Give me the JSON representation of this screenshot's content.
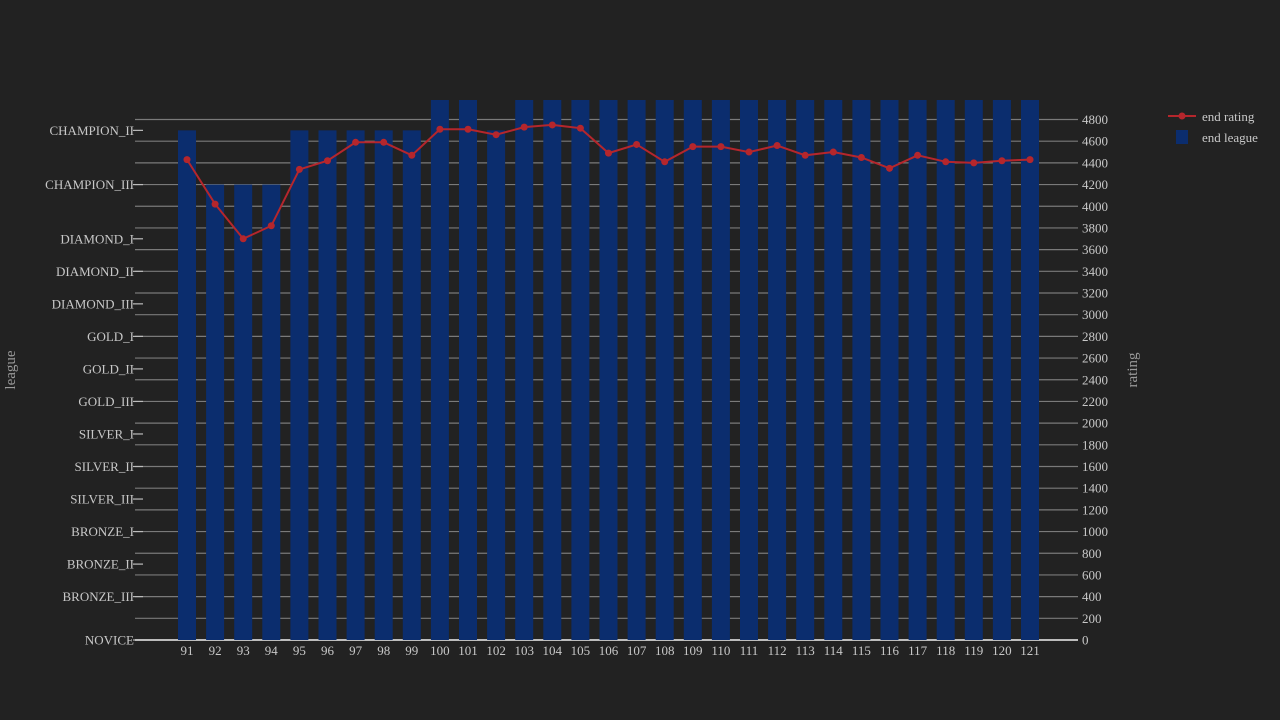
{
  "chart_data": {
    "type": "bar+line",
    "title": "",
    "xlabel": "",
    "ylabel_left": "league",
    "ylabel_right": "rating",
    "x": [
      91,
      92,
      93,
      94,
      95,
      96,
      97,
      98,
      99,
      100,
      101,
      102,
      103,
      104,
      105,
      106,
      107,
      108,
      109,
      110,
      111,
      112,
      113,
      114,
      115,
      116,
      117,
      118,
      119,
      120,
      121
    ],
    "league_ticks": [
      {
        "label": "NOVICE",
        "value": 0
      },
      {
        "label": "BRONZE_III",
        "value": 400
      },
      {
        "label": "BRONZE_II",
        "value": 700
      },
      {
        "label": "BRONZE_I",
        "value": 1000
      },
      {
        "label": "SILVER_III",
        "value": 1300
      },
      {
        "label": "SILVER_II",
        "value": 1600
      },
      {
        "label": "SILVER_I",
        "value": 1900
      },
      {
        "label": "GOLD_III",
        "value": 2200
      },
      {
        "label": "GOLD_II",
        "value": 2500
      },
      {
        "label": "GOLD_I",
        "value": 2800
      },
      {
        "label": "DIAMOND_III",
        "value": 3100
      },
      {
        "label": "DIAMOND_II",
        "value": 3400
      },
      {
        "label": "DIAMOND_I",
        "value": 3700
      },
      {
        "label": "CHAMPION_III",
        "value": 4200
      },
      {
        "label": "CHAMPION_II",
        "value": 4700
      }
    ],
    "rating_ticks": [
      0,
      200,
      400,
      600,
      800,
      1000,
      1200,
      1400,
      1600,
      1800,
      2000,
      2200,
      2400,
      2600,
      2800,
      3000,
      3200,
      3400,
      3600,
      3800,
      4000,
      4200,
      4400,
      4600,
      4800
    ],
    "rating_range": [
      0,
      4980
    ],
    "series": [
      {
        "name": "end rating",
        "type": "line",
        "axis": "right",
        "color": "#b5262c",
        "values": [
          4430,
          4020,
          3700,
          3820,
          4340,
          4420,
          4590,
          4590,
          4470,
          4710,
          4710,
          4660,
          4730,
          4750,
          4720,
          4490,
          4570,
          4410,
          4550,
          4550,
          4500,
          4560,
          4470,
          4500,
          4450,
          4350,
          4470,
          4410,
          4400,
          4420,
          4430
        ]
      },
      {
        "name": "end league",
        "type": "bar",
        "axis": "left",
        "color": "#0b2d6e",
        "values": [
          "CHAMPION_II",
          "CHAMPION_III",
          "CHAMPION_III",
          "CHAMPION_III",
          "CHAMPION_II",
          "CHAMPION_II",
          "CHAMPION_II",
          "CHAMPION_II",
          "CHAMPION_II",
          "CHAMPION_I",
          "CHAMPION_I",
          "CHAMPION_II",
          "CHAMPION_I",
          "CHAMPION_I",
          "CHAMPION_I",
          "CHAMPION_I",
          "CHAMPION_I",
          "CHAMPION_I",
          "CHAMPION_I",
          "CHAMPION_I",
          "CHAMPION_I",
          "CHAMPION_I",
          "CHAMPION_I",
          "CHAMPION_I",
          "CHAMPION_I",
          "CHAMPION_I",
          "CHAMPION_I",
          "CHAMPION_I",
          "CHAMPION_I",
          "CHAMPION_I",
          "CHAMPION_I"
        ]
      }
    ],
    "legend": {
      "position": "top-right",
      "items": [
        "end rating",
        "end league"
      ]
    },
    "grid": true
  },
  "colors": {
    "background": "#222222",
    "grid": "#7a7a7a",
    "tick_text": "#c8c8c8"
  }
}
